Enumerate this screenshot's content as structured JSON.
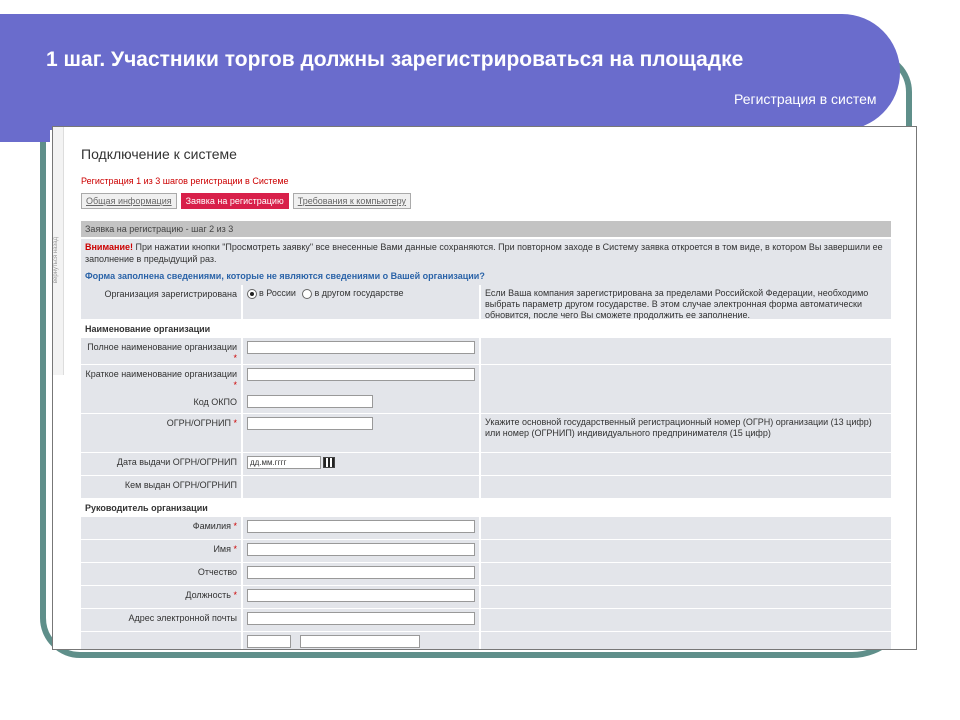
{
  "slide": {
    "title": "1 шаг. Участники торгов должны зарегистрироваться на площадке",
    "subtitle": "Регистрация в систем"
  },
  "screenshot": {
    "side_text": "вернуться назад",
    "page_title": "Подключение к системе",
    "step_note": "Регистрация 1 из 3 шагов регистрации в Системе",
    "tabs": [
      {
        "label": "Общая информация",
        "active": false
      },
      {
        "label": "Заявка на регистрацию",
        "active": true
      },
      {
        "label": "Требования к компьютеру",
        "active": false
      }
    ],
    "step_bar": "Заявка на регистрацию - шаг 2 из 3",
    "warning": {
      "label": "Внимание!",
      "text": "При нажатии кнопки \"Просмотреть заявку\" все внесенные Вами данные сохраняются. При повторном заходе в Систему заявка откроется в том виде, в котором Вы завершили ее заполнение в предыдущий раз."
    },
    "form_question": "Форма заполнена сведениями, которые не являются сведениями о Вашей организации?",
    "org_registered": {
      "label": "Организация зарегистрирована",
      "options": [
        "в России",
        "в другом государстве"
      ],
      "selected": "в России",
      "hint": "Если Ваша компания зарегистрирована за пределами Российской Федерации, необходимо выбрать параметр другом государстве. В этом случае электронная форма автоматически обновится, после чего Вы сможете продолжить ее заполнение."
    },
    "section_org": "Наименование организации",
    "fields_org": [
      {
        "label": "Полное наименование организации",
        "required": true,
        "value": ""
      },
      {
        "label": "Краткое наименование организации",
        "required": true,
        "value": ""
      },
      {
        "label": "Код ОКПО",
        "required": false,
        "value": ""
      }
    ],
    "ogrn": {
      "label": "ОГРН/ОГРНИП",
      "required": true,
      "value": "",
      "hint": "Укажите основной государственный регистрационный номер (ОГРН) организации (13 цифр) или номер (ОГРНИП) индивидуального предпринимателя (15 цифр)"
    },
    "ogrn_date": {
      "label": "Дата выдачи ОГРН/ОГРНИП",
      "value": "дд.мм.гггг"
    },
    "ogrn_issuer": {
      "label": "Кем выдан ОГРН/ОГРНИП"
    },
    "section_head": "Руководитель организации",
    "fields_head": [
      {
        "label": "Фамилия",
        "required": true,
        "value": ""
      },
      {
        "label": "Имя",
        "required": true,
        "value": ""
      },
      {
        "label": "Отчество",
        "required": false,
        "value": ""
      },
      {
        "label": "Должность",
        "required": true,
        "value": ""
      },
      {
        "label": "Адрес электронной почты",
        "required": false,
        "value": ""
      }
    ],
    "required_mark": "*"
  },
  "colors": {
    "banner": "#6a6ccc",
    "frame": "#5f8f8a",
    "active_tab": "#d8204a",
    "warning_red": "#cc0000",
    "link_blue": "#2a63a8",
    "row_bg": "#e3e5ea"
  }
}
